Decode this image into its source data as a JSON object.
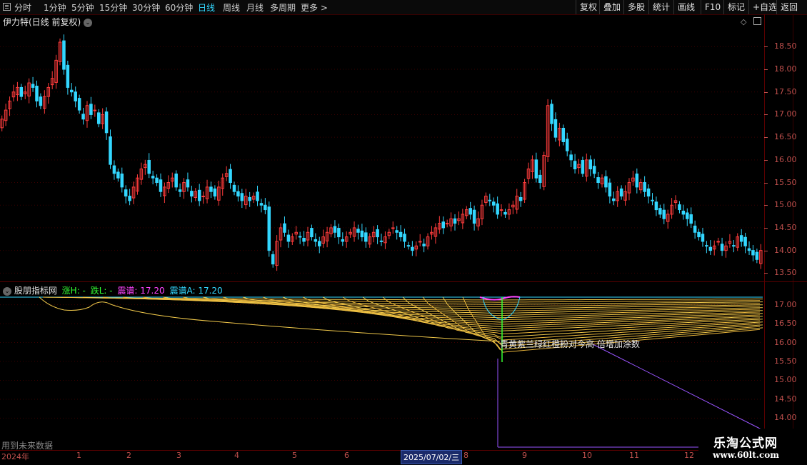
{
  "toolbar": {
    "tabs": [
      {
        "label": "分时",
        "active": false
      },
      {
        "label": "1分钟",
        "active": false
      },
      {
        "label": "5分钟",
        "active": false
      },
      {
        "label": "15分钟",
        "active": false
      },
      {
        "label": "30分钟",
        "active": false
      },
      {
        "label": "60分钟",
        "active": false
      },
      {
        "label": "日线",
        "active": true
      },
      {
        "label": "周线",
        "active": false
      },
      {
        "label": "月线",
        "active": false
      },
      {
        "label": "多周期",
        "active": false
      },
      {
        "label": "更多",
        "active": false
      }
    ],
    "more_chevron": ">",
    "right_buttons": [
      "复权",
      "叠加",
      "多股",
      "统计",
      "画线",
      "F10",
      "标记",
      "+自选",
      "返回"
    ]
  },
  "main_chart": {
    "title": "伊力特(日线 前复权)",
    "y_labels": [
      "18.50",
      "18.00",
      "17.50",
      "17.00",
      "16.50",
      "16.00",
      "15.50",
      "15.00",
      "14.50",
      "14.00",
      "13.50"
    ]
  },
  "indicator": {
    "name": "股朋指标网",
    "items": [
      {
        "text": "涨H: -",
        "color": "#33ff33"
      },
      {
        "text": "跌L: -",
        "color": "#33ff33"
      },
      {
        "text": "震谱: 17.20",
        "color": "#ff44ff"
      },
      {
        "text": "震谱A: 17.20",
        "color": "#33d7ff"
      }
    ],
    "y_labels": [
      "17.00",
      "16.50",
      "16.00",
      "15.50",
      "15.00",
      "14.50",
      "14.00"
    ],
    "annotation": "青黄紫兰绿红橙粉对今高 倍增加涂数"
  },
  "x_axis": {
    "labels": [
      "2024年",
      "1",
      "2",
      "3",
      "4",
      "5",
      "6",
      "8",
      "9",
      "10",
      "11",
      "12"
    ],
    "highlight_date": "2025/07/02/三"
  },
  "footer": {
    "note": "用到未来数据"
  },
  "watermark": {
    "line1": "乐淘公式网",
    "line2": "www.60lt.com"
  },
  "colors": {
    "up": "#ff3c3c",
    "down": "#33d7ff",
    "axis": "#c0504d",
    "grid": "#5a0000"
  },
  "chart_data": {
    "type": "candlestick",
    "title": "伊力特(日线 前复权)",
    "ylim": [
      13.3,
      18.9
    ],
    "closes": [
      16.9,
      17.1,
      17.3,
      17.5,
      17.6,
      17.4,
      17.5,
      17.7,
      17.6,
      17.3,
      17.2,
      17.4,
      17.6,
      17.8,
      18.2,
      18.6,
      18.0,
      17.6,
      17.5,
      17.3,
      17.1,
      16.9,
      17.2,
      17.0,
      17.1,
      16.8,
      17.0,
      16.6,
      15.9,
      15.7,
      15.6,
      15.4,
      15.2,
      15.1,
      15.4,
      15.6,
      15.8,
      15.9,
      15.7,
      15.6,
      15.5,
      15.3,
      15.4,
      15.5,
      15.6,
      15.4,
      15.3,
      15.5,
      15.4,
      15.2,
      15.3,
      15.1,
      15.2,
      15.4,
      15.3,
      15.2,
      15.4,
      15.6,
      15.7,
      15.5,
      15.3,
      15.2,
      15.1,
      15.2,
      15.1,
      15.2,
      15.1,
      15.0,
      14.9,
      14.0,
      13.7,
      14.2,
      14.5,
      14.4,
      14.2,
      14.3,
      14.4,
      14.3,
      14.2,
      14.4,
      14.3,
      14.2,
      14.1,
      14.3,
      14.4,
      14.5,
      14.4,
      14.3,
      14.2,
      14.3,
      14.4,
      14.5,
      14.4,
      14.3,
      14.2,
      14.3,
      14.4,
      14.3,
      14.2,
      14.3,
      14.4,
      14.5,
      14.4,
      14.3,
      14.2,
      14.1,
      14.0,
      14.1,
      14.2,
      14.1,
      14.3,
      14.4,
      14.5,
      14.6,
      14.5,
      14.6,
      14.7,
      14.6,
      14.7,
      14.8,
      14.9,
      14.8,
      14.6,
      14.7,
      15.0,
      15.2,
      15.1,
      15.0,
      14.8,
      14.9,
      14.8,
      14.9,
      15.0,
      15.2,
      15.1,
      15.5,
      15.8,
      16.0,
      15.6,
      15.5,
      16.1,
      17.2,
      16.8,
      16.5,
      16.7,
      16.4,
      16.2,
      16.0,
      15.8,
      15.9,
      15.7,
      16.0,
      15.8,
      15.7,
      15.5,
      15.6,
      15.4,
      15.2,
      15.1,
      15.3,
      15.2,
      15.3,
      15.5,
      15.6,
      15.4,
      15.5,
      15.3,
      15.2,
      15.1,
      14.9,
      14.8,
      14.7,
      14.8,
      15.0,
      15.1,
      14.9,
      14.8,
      14.7,
      14.6,
      14.4,
      14.3,
      14.2,
      14.1,
      14.0,
      14.1,
      14.2,
      14.0,
      14.1,
      14.2,
      14.1,
      14.3,
      14.2,
      14.1,
      14.0,
      13.9,
      13.8,
      14.0
    ]
  }
}
